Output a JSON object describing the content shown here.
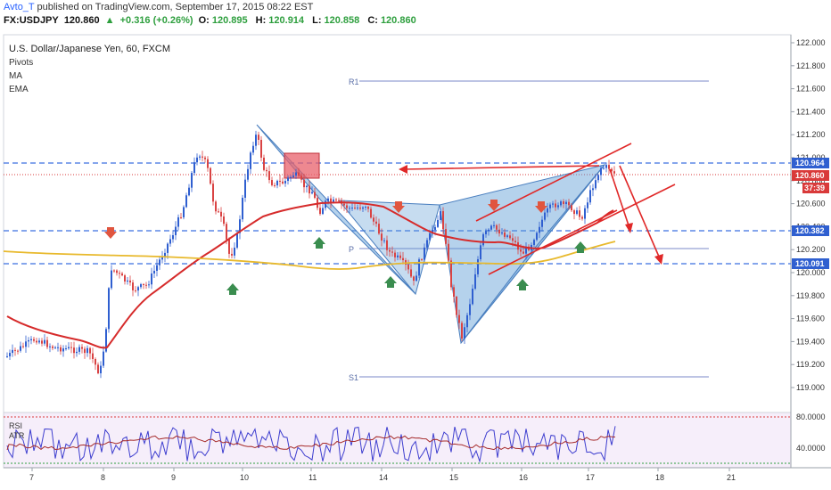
{
  "header": {
    "author": "Avto_T",
    "published_text": "published on TradingView.com, September 17, 2015 08:22 EST"
  },
  "quote": {
    "symbol": "FX:USDJPY",
    "last": "120.860",
    "change": "+0.316 (+0.26%)",
    "o_label": "O:",
    "o": "120.895",
    "h_label": "H:",
    "h": "120.914",
    "l_label": "L:",
    "l": "120.858",
    "c_label": "C:",
    "c": "120.860",
    "up_color": "#2e9f3e"
  },
  "legend": {
    "title": "U.S. Dollar/Japanese Yen, 60, FXCM",
    "items": [
      "Pivots",
      "MA",
      "EMA"
    ]
  },
  "pivots": {
    "r1": "R1",
    "p": "P",
    "s1": "S1"
  },
  "price_axis": {
    "ticks": [
      "122.000",
      "121.800",
      "121.600",
      "121.400",
      "121.200",
      "121.000",
      "120.800",
      "120.600",
      "120.400",
      "120.200",
      "120.000",
      "119.800",
      "119.600",
      "119.400",
      "119.200",
      "119.000"
    ],
    "badges": [
      {
        "text": "120.964",
        "color": "#2f5fd0"
      },
      {
        "text": "120.860",
        "color": "#d93a3a"
      },
      {
        "text": "37:39",
        "color": "#d93a3a"
      },
      {
        "text": "120.382",
        "color": "#2f5fd0"
      },
      {
        "text": "120.091",
        "color": "#2f5fd0"
      }
    ]
  },
  "rsi_panel": {
    "labels": [
      "RSI",
      "ATR"
    ],
    "ticks": [
      "80.0000",
      "40.0000"
    ]
  },
  "time_axis": {
    "labels": [
      "7",
      "8",
      "9",
      "10",
      "11",
      "14",
      "15",
      "16",
      "17",
      "18",
      "21"
    ]
  },
  "colors": {
    "candle": "#2f5fd0",
    "candle_down": "#d94343",
    "ema": "#d62b2b",
    "ma": "#e8b92c",
    "harmonic_fill": "#5b9bd5",
    "level_line": "#3a6fe0",
    "arrow_up": "#3a8d4f",
    "arrow_down": "#e0553f",
    "rsi_line": "#3e3ecf",
    "atr_line": "#a52a2a"
  }
}
